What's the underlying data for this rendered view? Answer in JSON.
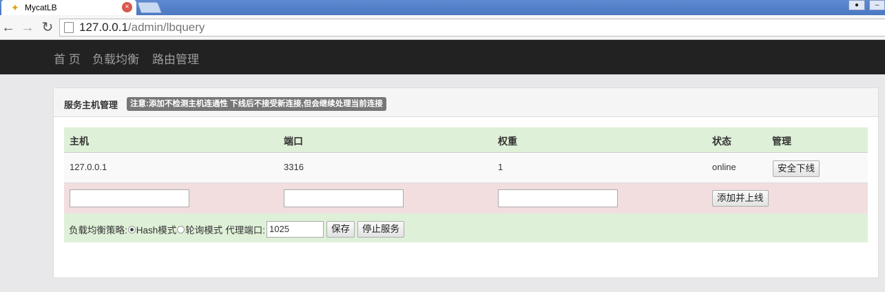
{
  "browser": {
    "tab_title": "MycatLB",
    "tab_close_glyph": "×",
    "url_host": "127.0.0.1",
    "url_path": "/admin/lbquery"
  },
  "navbar": {
    "items": [
      "首 页",
      "负载均衡",
      "路由管理"
    ]
  },
  "panel": {
    "title": "服务主机管理",
    "notice": "注意:添加不检测主机连通性 下线后不接受新连接,但会继续处理当前连接"
  },
  "table": {
    "headers": [
      "主机",
      "端口",
      "权重",
      "状态",
      "管理"
    ],
    "rows": [
      {
        "host": "127.0.0.1",
        "port": "3316",
        "weight": "1",
        "status": "online",
        "action": "安全下线"
      }
    ],
    "add_button": "添加并上线"
  },
  "policy": {
    "label": "负载均衡策略:",
    "options": [
      "Hash模式",
      "轮询模式"
    ],
    "selected": "Hash模式",
    "port_label": "代理端口:",
    "port_value": "1025",
    "save_button": "保存",
    "stop_button": "停止服务"
  },
  "icons": {
    "back": "back-arrow-icon",
    "forward": "forward-arrow-icon",
    "reload": "reload-icon",
    "page": "page-icon",
    "favicon": "mycat-favicon-icon"
  }
}
